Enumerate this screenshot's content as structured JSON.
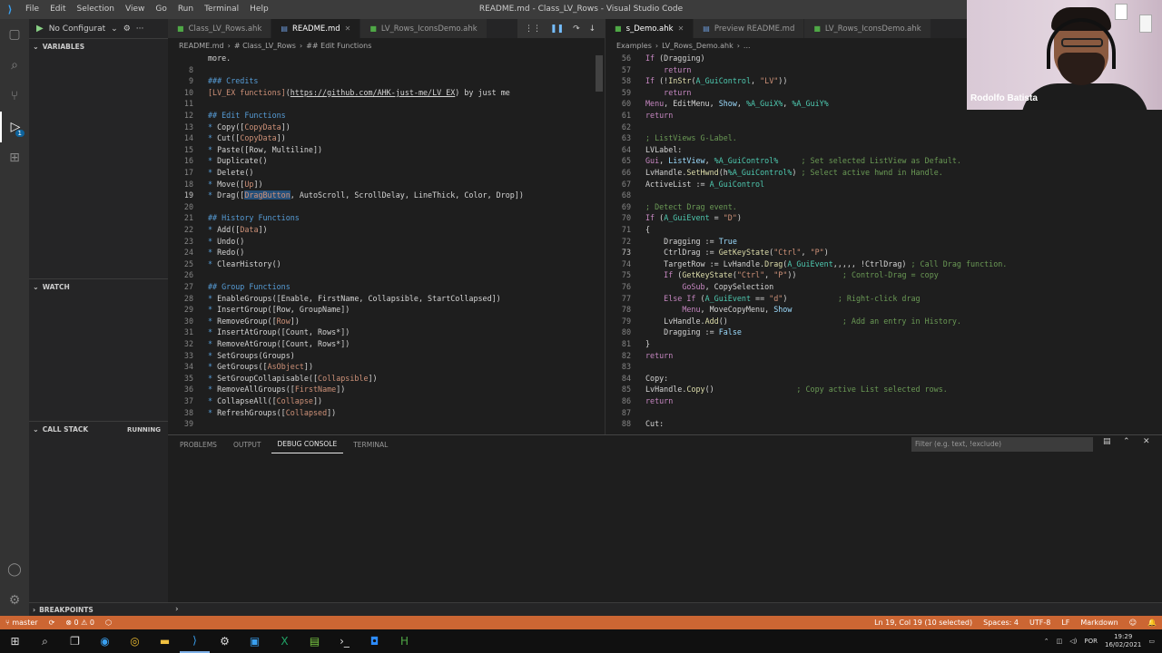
{
  "window": {
    "title": "README.md - Class_LV_Rows - Visual Studio Code",
    "menu": [
      "File",
      "Edit",
      "Selection",
      "View",
      "Go",
      "Run",
      "Terminal",
      "Help"
    ],
    "controls": [
      "—",
      "❐",
      "✕"
    ]
  },
  "sidebar": {
    "run_config": "No Configurat",
    "sections": {
      "variables": "VARIABLES",
      "watch": "WATCH",
      "call_stack": "CALL STACK",
      "call_stack_status": "RUNNING",
      "breakpoints": "BREAKPOINTS"
    }
  },
  "editor_left": {
    "tabs": [
      {
        "label": "Class_LV_Rows.ahk",
        "active": false
      },
      {
        "label": "README.md",
        "active": true
      },
      {
        "label": "LV_Rows_IconsDemo.ahk",
        "active": false
      }
    ],
    "breadcrumb": [
      "README.md",
      "# Class_LV_Rows",
      "## Edit Functions"
    ],
    "lines": [
      {
        "n": "",
        "t": "more."
      },
      {
        "n": "8",
        "t": ""
      },
      {
        "n": "9",
        "t": "### Credits"
      },
      {
        "n": "10",
        "t": "[LV_EX functions](https://github.com/AHK-just-me/LV_EX) by just me"
      },
      {
        "n": "11",
        "t": ""
      },
      {
        "n": "12",
        "t": "## Edit Functions"
      },
      {
        "n": "13",
        "t": "* Copy([CopyData])"
      },
      {
        "n": "14",
        "t": "* Cut([CopyData])"
      },
      {
        "n": "15",
        "t": "* Paste([Row, Multiline])"
      },
      {
        "n": "16",
        "t": "* Duplicate()"
      },
      {
        "n": "17",
        "t": "* Delete()"
      },
      {
        "n": "18",
        "t": "* Move([Up])"
      },
      {
        "n": "19",
        "t": "* Drag([DragButton, AutoScroll, ScrollDelay, LineThick, Color, Drop])"
      },
      {
        "n": "20",
        "t": ""
      },
      {
        "n": "21",
        "t": "## History Functions"
      },
      {
        "n": "22",
        "t": "* Add([Data])"
      },
      {
        "n": "23",
        "t": "* Undo()"
      },
      {
        "n": "24",
        "t": "* Redo()"
      },
      {
        "n": "25",
        "t": "* ClearHistory()"
      },
      {
        "n": "26",
        "t": ""
      },
      {
        "n": "27",
        "t": "## Group Functions"
      },
      {
        "n": "28",
        "t": "* EnableGroups([Enable, FirstName, Collapsible, StartCollapsed])"
      },
      {
        "n": "29",
        "t": "* InsertGroup([Row, GroupName])"
      },
      {
        "n": "30",
        "t": "* RemoveGroup([Row])"
      },
      {
        "n": "31",
        "t": "* InsertAtGroup([Count, Rows*])"
      },
      {
        "n": "32",
        "t": "* RemoveAtGroup([Count, Rows*])"
      },
      {
        "n": "33",
        "t": "* SetGroups(Groups)"
      },
      {
        "n": "34",
        "t": "* GetGroups([AsObject])"
      },
      {
        "n": "35",
        "t": "* SetGroupCollapisable([Collapsible])"
      },
      {
        "n": "36",
        "t": "* RemoveAllGroups([FirstName])"
      },
      {
        "n": "37",
        "t": "* CollapseAll([Collapse])"
      },
      {
        "n": "38",
        "t": "* RefreshGroups([Collapsed])"
      },
      {
        "n": "39",
        "t": ""
      }
    ]
  },
  "editor_right": {
    "tabs": [
      {
        "label": "s_Demo.ahk",
        "active": true
      },
      {
        "label": "Preview README.md",
        "active": false
      },
      {
        "label": "LV_Rows_IconsDemo.ahk",
        "active": false
      }
    ],
    "breadcrumb": [
      "Examples",
      "LV_Rows_Demo.ahk",
      "..."
    ],
    "lines": [
      {
        "n": "56",
        "t": "If (Dragging)"
      },
      {
        "n": "57",
        "t": "    return"
      },
      {
        "n": "58",
        "t": "If (!InStr(A_GuiControl, \"LV\"))"
      },
      {
        "n": "59",
        "t": "    return"
      },
      {
        "n": "60",
        "t": "Menu, EditMenu, Show, %A_GuiX%, %A_GuiY%"
      },
      {
        "n": "61",
        "t": "return"
      },
      {
        "n": "62",
        "t": ""
      },
      {
        "n": "63",
        "t": "; ListViews G-Label."
      },
      {
        "n": "64",
        "t": "LVLabel:"
      },
      {
        "n": "65",
        "t": "Gui, ListView, %A_GuiControl%     ; Set selected ListView as Default."
      },
      {
        "n": "66",
        "t": "LvHandle.SetHwnd(h%A_GuiControl%) ; Select active hwnd in Handle."
      },
      {
        "n": "67",
        "t": "ActiveList := A_GuiControl"
      },
      {
        "n": "68",
        "t": ""
      },
      {
        "n": "69",
        "t": "; Detect Drag event."
      },
      {
        "n": "70",
        "t": "If (A_GuiEvent = \"D\")"
      },
      {
        "n": "71",
        "t": "{"
      },
      {
        "n": "72",
        "t": "    Dragging := True"
      },
      {
        "n": "73",
        "t": "    CtrlDrag := GetKeyState(\"Ctrl\", \"P\")"
      },
      {
        "n": "74",
        "t": "    TargetRow := LvHandle.Drag(A_GuiEvent,,,,, !CtrlDrag) ; Call Drag function."
      },
      {
        "n": "75",
        "t": "    If (GetKeyState(\"Ctrl\", \"P\"))          ; Control-Drag = copy"
      },
      {
        "n": "76",
        "t": "        GoSub, CopySelection"
      },
      {
        "n": "77",
        "t": "    Else If (A_GuiEvent == \"d\")           ; Right-click drag"
      },
      {
        "n": "78",
        "t": "        Menu, MoveCopyMenu, Show"
      },
      {
        "n": "79",
        "t": "    LvHandle.Add()                         ; Add an entry in History."
      },
      {
        "n": "80",
        "t": "    Dragging := False"
      },
      {
        "n": "81",
        "t": "}"
      },
      {
        "n": "82",
        "t": "return"
      },
      {
        "n": "83",
        "t": ""
      },
      {
        "n": "84",
        "t": "Copy:"
      },
      {
        "n": "85",
        "t": "LvHandle.Copy()                  ; Copy active List selected rows."
      },
      {
        "n": "86",
        "t": "return"
      },
      {
        "n": "87",
        "t": ""
      },
      {
        "n": "88",
        "t": "Cut:"
      }
    ]
  },
  "panel": {
    "tabs": [
      "PROBLEMS",
      "OUTPUT",
      "DEBUG CONSOLE",
      "TERMINAL"
    ],
    "active_tab": "DEBUG CONSOLE",
    "filter_placeholder": "Filter (e.g. text, !exclude)"
  },
  "statusbar": {
    "branch": "master",
    "errors": "0",
    "warnings": "0",
    "cursor": "Ln 19, Col 19 (10 selected)",
    "spaces": "Spaces: 4",
    "encoding": "UTF-8",
    "eol": "LF",
    "language": "Markdown",
    "color": "#cc6633"
  },
  "taskbar": {
    "lang": "POR",
    "time": "19:29",
    "date": "16/02/2021"
  },
  "webcam": {
    "name": "Rodolfo Batista"
  }
}
